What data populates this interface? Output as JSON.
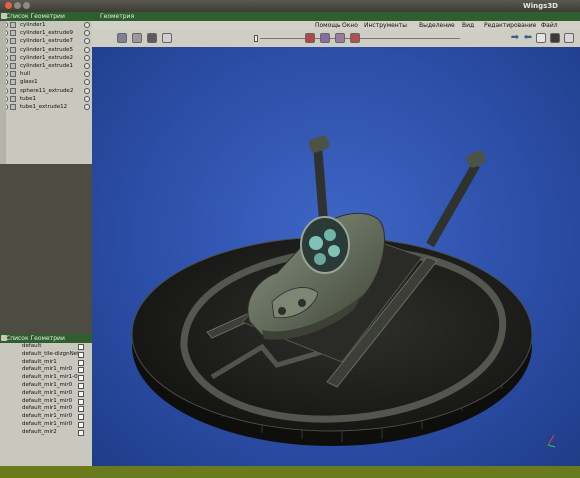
{
  "window": {
    "app_title": "Wings3D"
  },
  "outliner": {
    "title": "Список Геометрии",
    "rows": [
      "cylinder1",
      "cylinder1_extrude9",
      "cylinder1_extrude7",
      "cylinder1_extrude5",
      "cylinder1_extrude2",
      "cylinder1_extrude1",
      "hull",
      "glass1",
      "sphere11_extrude2",
      "tube1",
      "tube1_extrude12"
    ]
  },
  "geolist": {
    "title": "Список Геометрии",
    "rows": [
      "default",
      "default_tile-dizgnNetr",
      "default_mir1",
      "default_mir1_mir0",
      "default_mir1_mir1-0",
      "default_mir1_mir0",
      "default_mir1_mir0",
      "default_mir1_mir0",
      "default_mir1_mir0",
      "default_mir1_mir0",
      "default_mir1_mir0",
      "default_mir2"
    ]
  },
  "geometry": {
    "title": "Геометрия",
    "menu": [
      "Файл",
      "Редактирование",
      "Вид",
      "Выделение",
      "Инструменты",
      "Окно",
      "Помощь"
    ]
  },
  "colors": {
    "panel_header": "#2f5f2f",
    "viewport_bg": "#2c4fa8",
    "disc_dark": "#1e1f1d",
    "craft_body": "#4c5445",
    "canopy": "#7ec3b6"
  }
}
